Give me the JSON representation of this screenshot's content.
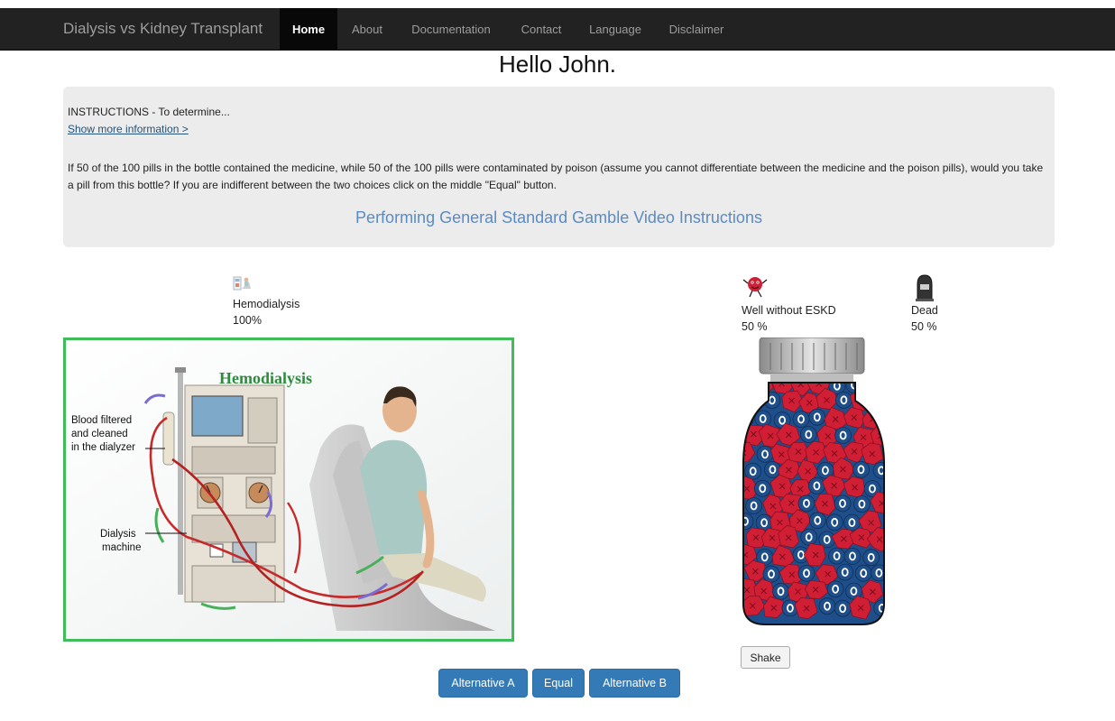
{
  "navbar": {
    "brand": "Dialysis vs Kidney Transplant",
    "items": [
      {
        "label": "Home",
        "active": true
      },
      {
        "label": "About"
      },
      {
        "label": "Documentation"
      },
      {
        "label": "Contact"
      },
      {
        "label": "Language"
      },
      {
        "label": "Disclaimer"
      }
    ]
  },
  "greeting": "Hello John.",
  "instructions": {
    "text": "INSTRUCTIONS - To determine...",
    "show_more": "Show more information >",
    "question": "If 50 of the 100 pills in the bottle contained the medicine, while 50 of the 100 pills were contaminated by poison (assume you cannot differentiate between the medicine and the poison pills), would you take a pill from this bottle? If you are indifferent between the two choices click on the middle \"Equal\" button.",
    "video_link": "Performing General Standard Gamble Video Instructions"
  },
  "option_a": {
    "name": "Hemodialysis",
    "percent": "100%",
    "illustration": {
      "title": "Hemodialysis",
      "label_filter_1": "Blood filtered",
      "label_filter_2": "and cleaned",
      "label_filter_3": "in the dialyzer",
      "label_machine_1": "Dialysis",
      "label_machine_2": "machine"
    }
  },
  "option_b": {
    "good_outcome": {
      "name": "Well without ESKD",
      "percent": "50 %"
    },
    "bad_outcome": {
      "name": "Dead",
      "percent": "50 %"
    },
    "medicine_pills_fraction": 0.5,
    "poison_pills_fraction": 0.5
  },
  "shake_label": "Shake",
  "buttons": {
    "alt_a": "Alternative A",
    "equal": "Equal",
    "alt_b": "Alternative B"
  },
  "colors": {
    "navbar": "#222222",
    "accent_blue": "#337ab7",
    "frame_green": "#3fbd5a",
    "pill_red": "#d01f35",
    "pill_blue": "#1f4f8a"
  }
}
